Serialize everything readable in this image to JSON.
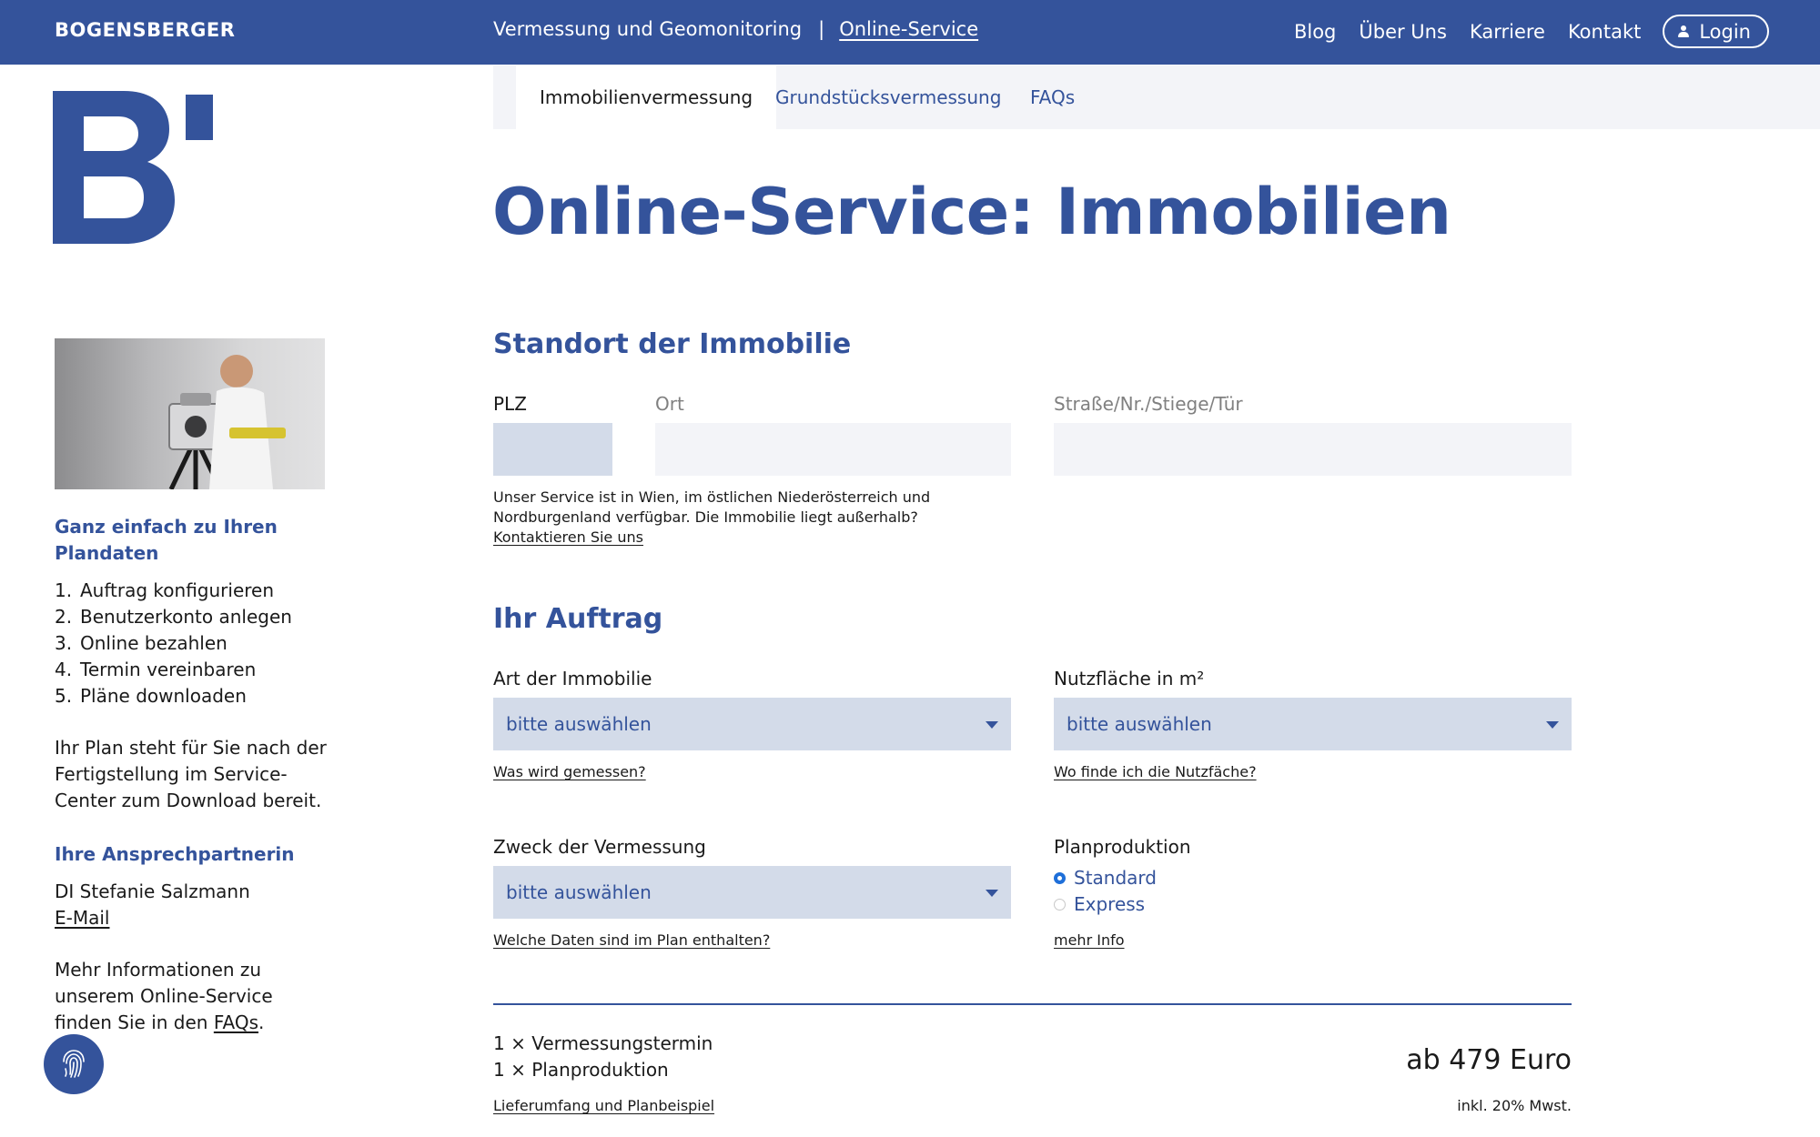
{
  "topbar": {
    "brand": "BOGENSBERGER",
    "nav_center": [
      {
        "label": "Vermessung und Geomonitoring"
      },
      {
        "separator": "|"
      },
      {
        "label": "Online-Service"
      }
    ],
    "nav_right": [
      "Blog",
      "Über Uns",
      "Karriere",
      "Kontakt"
    ],
    "login_label": "Login"
  },
  "subtabs": [
    "Immobilienvermessung",
    "Grundstücksvermessung",
    "FAQs"
  ],
  "page_title": "Online-Service: Immobilien",
  "sidebar": {
    "heading": "Ganz einfach zu Ihren Plandaten",
    "steps": [
      {
        "num": "1.",
        "label": "Auftrag konfigurieren"
      },
      {
        "num": "2.",
        "label": "Benutzerkonto anlegen"
      },
      {
        "num": "3.",
        "label": "Online bezahlen"
      },
      {
        "num": "4.",
        "label": "Termin vereinbaren"
      },
      {
        "num": "5.",
        "label": "Pläne downloaden"
      }
    ],
    "plan_text": "Ihr Plan steht für Sie nach der Fertigstellung im Service-Center zum Download bereit.",
    "contact_heading": "Ihre Ansprechpartnerin",
    "contact_name": "DI Stefanie Salzmann",
    "contact_email_link": "E-Mail",
    "more_info_prefix": "Mehr Informationen zu unserem Online-Service finden Sie in den ",
    "more_info_link": "FAQs",
    "more_info_suffix": "."
  },
  "location": {
    "heading": "Standort der Immobilie",
    "plz_label": "PLZ",
    "ort_label": "Ort",
    "street_label": "Straße/Nr./Stiege/Tür",
    "service_note": "Unser Service ist in Wien, im östlichen Niederösterreich und Nordburgenland verfügbar. Die Immobilie liegt außerhalb?",
    "contact_link": "Kontaktieren Sie uns"
  },
  "order": {
    "heading": "Ihr Auftrag",
    "type_label": "Art der Immobilie",
    "type_value": "bitte auswählen",
    "type_help": "Was wird gemessen?",
    "area_label": "Nutzfläche in m²",
    "area_value": "bitte auswählen",
    "area_help": "Wo finde ich die Nutzfäche?",
    "purpose_label": "Zweck der Vermessung",
    "purpose_value": "bitte auswählen",
    "purpose_help": "Welche Daten sind im Plan enthalten?",
    "production_label": "Planproduktion",
    "production_options": [
      "Standard",
      "Express"
    ],
    "production_selected": "Standard",
    "production_help": "mehr Info"
  },
  "summary": {
    "items": [
      "1 × Vermessungstermin",
      "1 × Planproduktion"
    ],
    "scope_link": "Lieferumfang und Planbeispiel",
    "price": "ab 479 Euro",
    "tax_note": "inkl. 20% Mwst."
  },
  "colors": {
    "brand_blue": "#34539b",
    "field_bg": "#f3f4f8",
    "select_bg": "#d3dbe9",
    "radio_active": "#1e6fd9"
  }
}
